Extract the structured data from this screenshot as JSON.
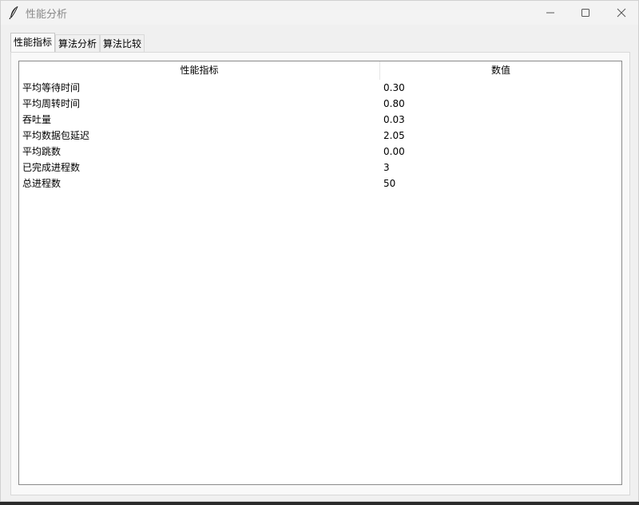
{
  "window": {
    "title": "性能分析"
  },
  "tabs": [
    {
      "label": "性能指标",
      "active": true
    },
    {
      "label": "算法分析",
      "active": false
    },
    {
      "label": "算法比较",
      "active": false
    }
  ],
  "table": {
    "headers": [
      "性能指标",
      "数值"
    ],
    "rows": [
      [
        "平均等待时间",
        "0.30"
      ],
      [
        "平均周转时间",
        "0.80"
      ],
      [
        "吞吐量",
        "0.03"
      ],
      [
        "平均数据包延迟",
        "2.05"
      ],
      [
        "平均跳数",
        "0.00"
      ],
      [
        "已完成进程数",
        "3"
      ],
      [
        "总进程数",
        "50"
      ]
    ]
  },
  "icons": {
    "app": "feather-icon",
    "minimize": "minimize-icon",
    "maximize": "maximize-icon",
    "close": "close-icon"
  }
}
